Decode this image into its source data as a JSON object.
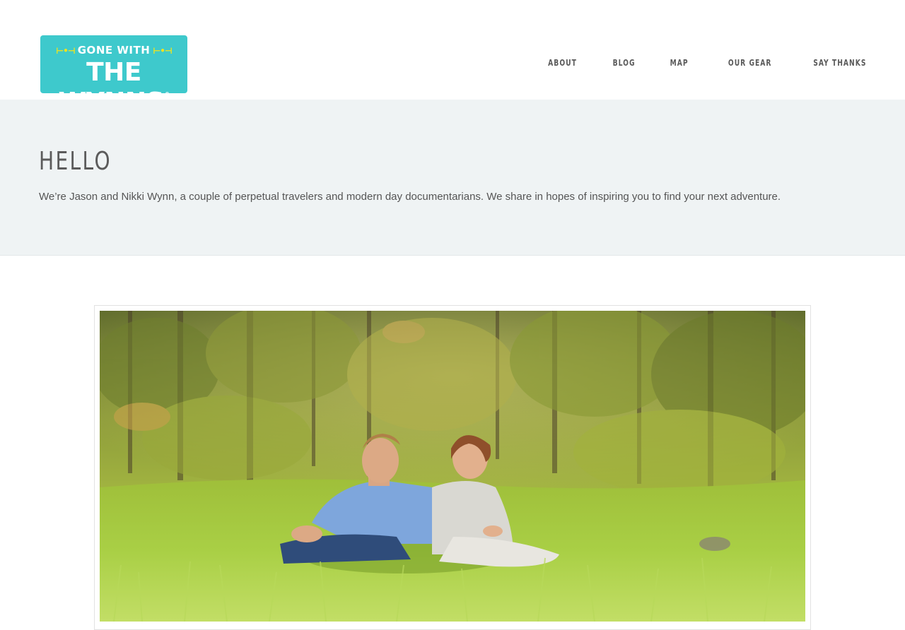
{
  "site": {
    "logo": {
      "line1": "GONE WITH",
      "line2": "THE WYNNS",
      "registered_mark": "®",
      "background_color": "#3ec9cc",
      "accent_color": "#f2e31c"
    },
    "nav": {
      "items": [
        {
          "label": "ABOUT"
        },
        {
          "label": "BLOG"
        },
        {
          "label": "MAP"
        },
        {
          "label": "OUR GEAR"
        },
        {
          "label": "SAY THANKS"
        }
      ]
    }
  },
  "hero": {
    "title": "HELLO",
    "text": "We’re Jason and Nikki Wynn, a couple of perpetual travelers and modern day documentarians. We share in hopes of inspiring you to find your next adventure.",
    "background_color": "#eff3f4"
  },
  "photo": {
    "subject": "couple-sitting-in-tall-grass-photo"
  }
}
